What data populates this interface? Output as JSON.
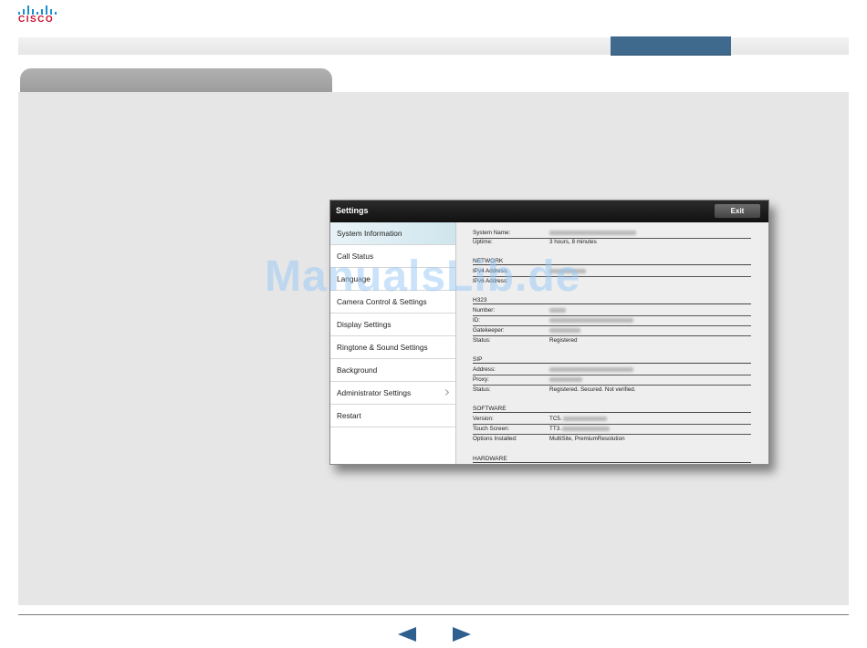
{
  "brand": {
    "logo_text": "CISCO",
    "logo_color": "#c8102e",
    "bar_color": "#1a8fd1"
  },
  "colors": {
    "nav_active": "#3f6a8e",
    "content_bg": "#e6e6e6",
    "arrow": "#2f5f8f"
  },
  "watermark": "ManualsLib.de",
  "settings": {
    "title": "Settings",
    "exit_label": "Exit",
    "menu": [
      {
        "label": "System Information",
        "active": true
      },
      {
        "label": "Call Status"
      },
      {
        "label": "Language"
      },
      {
        "label": "Camera Control & Settings"
      },
      {
        "label": "Display Settings"
      },
      {
        "label": "Ringtone & Sound Settings"
      },
      {
        "label": "Background"
      },
      {
        "label": "Administrator Settings",
        "has_chevron": true
      },
      {
        "label": "Restart"
      }
    ],
    "detail": {
      "system_name_label": "System Name:",
      "uptime_label": "Uptime:",
      "uptime_value": "3 hours, 8 minutes",
      "network_heading": "NETWORK",
      "ipv4_label": "IPv4 Address:",
      "ipv6_label": "IPv6 Address:",
      "h323_heading": "H323",
      "h323_number_label": "Number:",
      "h323_id_label": "ID:",
      "h323_gatekeeper_label": "Gatekeeper:",
      "h323_status_label": "Status:",
      "h323_status_value": "Registered",
      "sip_heading": "SIP",
      "sip_address_label": "Address:",
      "sip_proxy_label": "Proxy:",
      "sip_status_label": "Status:",
      "sip_status_value": "Registered. Secured. Not verified.",
      "software_heading": "SOFTWARE",
      "version_label": "Version:",
      "version_prefix": "TC5.",
      "touch_label": "Touch Screen:",
      "touch_prefix": "TT3.",
      "options_label": "Options Installed:",
      "options_value": "MultiSite, PremiumResolution",
      "hardware_heading": "HARDWARE"
    }
  }
}
